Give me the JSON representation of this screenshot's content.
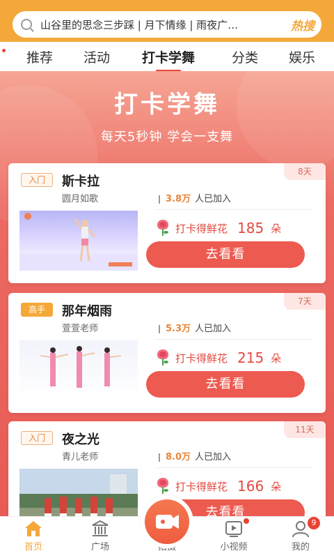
{
  "search": {
    "query_text": "山谷里的思念三步踩 | 月下情缘 | 雨夜广…",
    "hot_label": "热搜"
  },
  "tabs": [
    {
      "label": "推荐"
    },
    {
      "label": "活动"
    },
    {
      "label": "打卡学舞",
      "active": true
    },
    {
      "label": "分类"
    },
    {
      "label": "娱乐"
    }
  ],
  "hero": {
    "title": "打卡学舞",
    "subtitle": "每天5秒钟  学会一支舞"
  },
  "cards": [
    {
      "level": "入门",
      "title": "斯卡拉",
      "teacher": "圆月如歌",
      "days": "8天",
      "joined_count": "3.8万",
      "joined_suffix": "人已加入",
      "reward_label": "打卡得鲜花",
      "reward_count": "185",
      "reward_unit": "朵",
      "button_label": "去看看"
    },
    {
      "level": "高手",
      "title": "那年烟雨",
      "teacher": "萱萱老师",
      "days": "7天",
      "joined_count": "5.3万",
      "joined_suffix": "人已加入",
      "reward_label": "打卡得鲜花",
      "reward_count": "215",
      "reward_unit": "朵",
      "button_label": "去看看"
    },
    {
      "level": "入门",
      "title": "夜之光",
      "teacher": "青儿老师",
      "days": "11天",
      "joined_count": "8.0万",
      "joined_suffix": "人已加入",
      "reward_label": "打卡得鲜花",
      "reward_count": "166",
      "reward_unit": "朵",
      "button_label": "去看看"
    }
  ],
  "bottom_nav": [
    {
      "label": "首页",
      "icon": "home-icon",
      "active": true
    },
    {
      "label": "广场",
      "icon": "plaza-icon"
    },
    {
      "label": "拍摄",
      "icon": "camera-icon"
    },
    {
      "label": "小视频",
      "icon": "video-icon",
      "dot": true
    },
    {
      "label": "我的",
      "icon": "profile-icon",
      "badge": "9"
    }
  ],
  "colors": {
    "accent_orange": "#f4a83a",
    "primary_red": "#ec5a50"
  }
}
